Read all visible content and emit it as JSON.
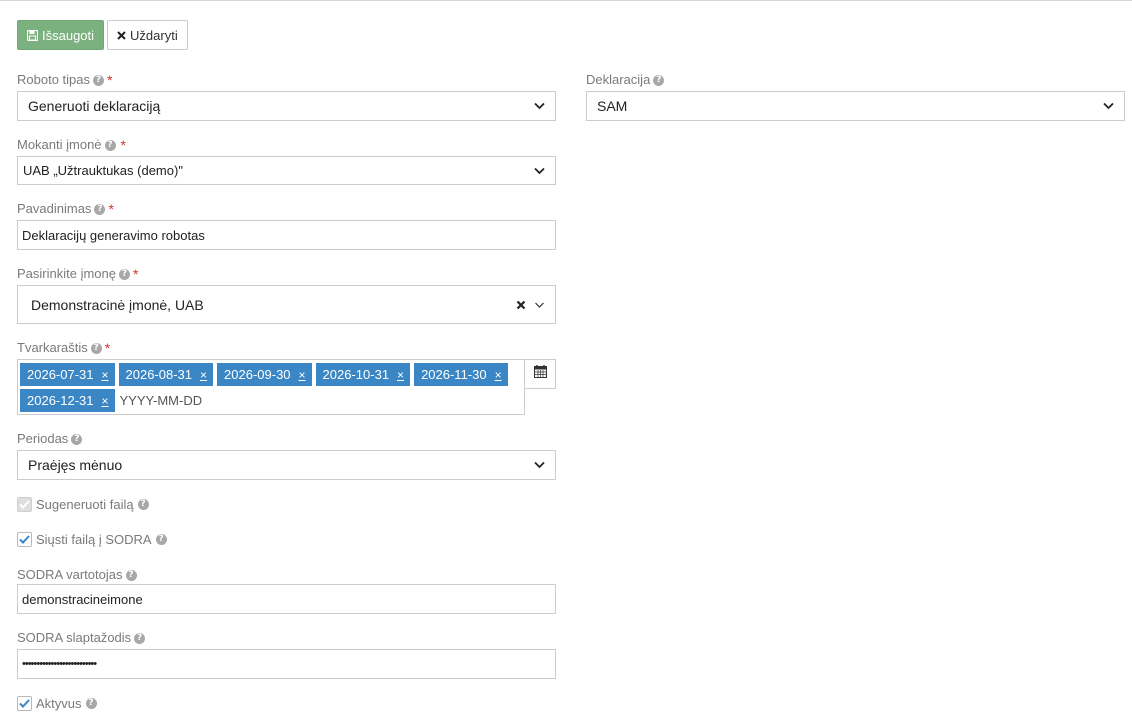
{
  "toolbar": {
    "save_label": "Išsaugoti",
    "close_label": "Uždaryti"
  },
  "form": {
    "robot_type": {
      "label": "Roboto tipas",
      "value": "Generuoti deklaraciją"
    },
    "declaration": {
      "label": "Deklaracija",
      "value": "SAM"
    },
    "paying_company": {
      "label": "Mokanti įmonė",
      "value": "UAB „Užtrauktukas (demo)\""
    },
    "name": {
      "label": "Pavadinimas",
      "value": "Deklaracijų generavimo robotas"
    },
    "choose_company": {
      "label": "Pasirinkite įmonę",
      "value": "Demonstracinė įmonė, UAB"
    },
    "schedule": {
      "label": "Tvarkaraštis",
      "dates": [
        "2026-07-31",
        "2026-08-31",
        "2026-09-30",
        "2026-10-31",
        "2026-11-30",
        "2026-12-31"
      ],
      "remove_symbol": "×",
      "placeholder": "YYYY-MM-DD"
    },
    "period": {
      "label": "Periodas",
      "value": "Praėjęs mėnuo"
    },
    "generate_file": {
      "label": "Sugeneruoti failą",
      "checked": true,
      "disabled": true
    },
    "send_sodra": {
      "label": "Siųsti failą į SODRA",
      "checked": true
    },
    "sodra_user": {
      "label": "SODRA vartotojas",
      "value": "demonstracineimone"
    },
    "sodra_password": {
      "label": "SODRA slaptažodis",
      "value": "••••••••••••••••••••••••••"
    },
    "active": {
      "label": "Aktyvus",
      "checked": true
    },
    "required_mark": "*",
    "help_glyph": "?"
  },
  "icons": {
    "save": "floppy-disk-icon",
    "close": "times-icon",
    "help": "question-circle-icon",
    "chevron": "chevron-down-icon",
    "calendar": "calendar-icon",
    "clear": "times-icon",
    "check": "check-icon"
  },
  "colors": {
    "save_button": "#7bb17e",
    "tag": "#3b87c6",
    "required": "#d9302a",
    "label": "#7a7a7a",
    "checkbox_check": "#3b87c6"
  }
}
